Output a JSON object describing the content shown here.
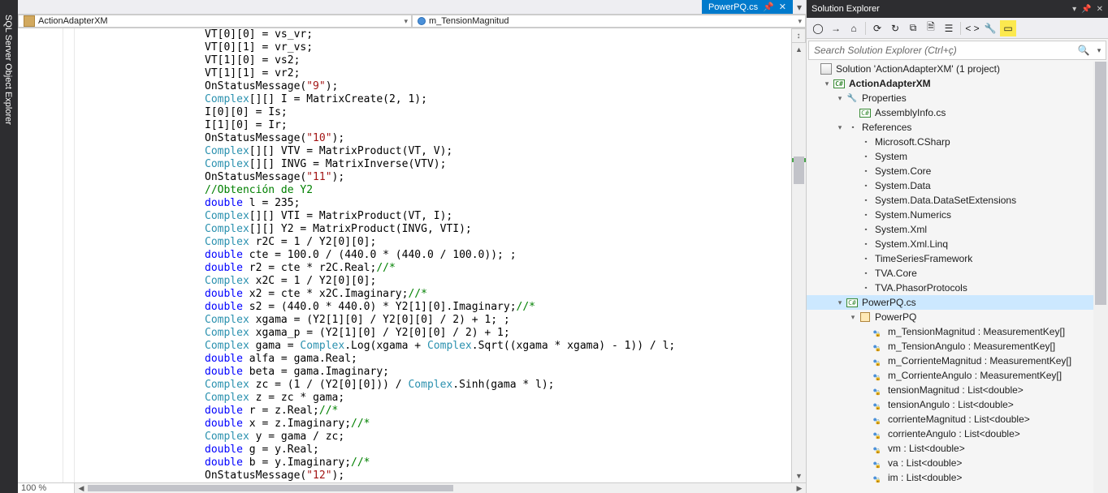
{
  "vertical_tab": "SQL Server Object Explorer",
  "tabs": {
    "active": "PowerPQ.cs",
    "dropdown_glyph": "▾"
  },
  "nav": {
    "left": "ActionAdapterXM",
    "right": "m_TensionMagnitud"
  },
  "zoom": "100 %",
  "code_lines": [
    [
      [
        "",
        "VT[0][0] = vs_vr;"
      ]
    ],
    [
      [
        "",
        "VT[0][1] = vr_vs;"
      ]
    ],
    [
      [
        "",
        "VT[1][0] = vs2;"
      ]
    ],
    [
      [
        "",
        "VT[1][1] = vr2;"
      ]
    ],
    [
      [
        "",
        "OnStatusMessage("
      ],
      [
        "str",
        "\"9\""
      ],
      [
        "",
        ");"
      ]
    ],
    [
      [
        "typ",
        "Complex"
      ],
      [
        "",
        "[][] I = MatrixCreate(2, 1);"
      ]
    ],
    [
      [
        "",
        "I[0][0] = Is;"
      ]
    ],
    [
      [
        "",
        "I[1][0] = Ir;"
      ]
    ],
    [
      [
        "",
        "OnStatusMessage("
      ],
      [
        "str",
        "\"10\""
      ],
      [
        "",
        ");"
      ]
    ],
    [
      [
        "typ",
        "Complex"
      ],
      [
        "",
        "[][] VTV = MatrixProduct(VT, V);"
      ]
    ],
    [
      [
        "typ",
        "Complex"
      ],
      [
        "",
        "[][] INVG = MatrixInverse(VTV);"
      ]
    ],
    [
      [
        "",
        "OnStatusMessage("
      ],
      [
        "str",
        "\"11\""
      ],
      [
        "",
        ");"
      ]
    ],
    [
      [
        "com",
        "//Obtención de Y2"
      ]
    ],
    [
      [
        "kw",
        "double"
      ],
      [
        "",
        " l = 235;"
      ]
    ],
    [
      [
        "typ",
        "Complex"
      ],
      [
        "",
        "[][] VTI = MatrixProduct(VT, I);"
      ]
    ],
    [
      [
        "typ",
        "Complex"
      ],
      [
        "",
        "[][] Y2 = MatrixProduct(INVG, VTI);"
      ]
    ],
    [
      [
        "typ",
        "Complex"
      ],
      [
        "",
        " r2C = 1 / Y2[0][0];"
      ]
    ],
    [
      [
        "kw",
        "double"
      ],
      [
        "",
        " cte = 100.0 / (440.0 * (440.0 / 100.0)); ;"
      ]
    ],
    [
      [
        "kw",
        "double"
      ],
      [
        "",
        " r2 = cte * r2C.Real;"
      ],
      [
        "com",
        "//*"
      ]
    ],
    [
      [
        "typ",
        "Complex"
      ],
      [
        "",
        " x2C = 1 / Y2[0][0];"
      ]
    ],
    [
      [
        "kw",
        "double"
      ],
      [
        "",
        " x2 = cte * x2C.Imaginary;"
      ],
      [
        "com",
        "//*"
      ]
    ],
    [
      [
        "kw",
        "double"
      ],
      [
        "",
        " s2 = (440.0 * 440.0) * Y2[1][0].Imaginary;"
      ],
      [
        "com",
        "//*"
      ]
    ],
    [
      [
        "typ",
        "Complex"
      ],
      [
        "",
        " xgama = (Y2[1][0] / Y2[0][0] / 2) + 1; ;"
      ]
    ],
    [
      [
        "typ",
        "Complex"
      ],
      [
        "",
        " xgama_p = (Y2[1][0] / Y2[0][0] / 2) + 1;"
      ]
    ],
    [
      [
        "typ",
        "Complex"
      ],
      [
        "",
        " gama = "
      ],
      [
        "typ",
        "Complex"
      ],
      [
        "",
        ".Log(xgama + "
      ],
      [
        "typ",
        "Complex"
      ],
      [
        "",
        ".Sqrt((xgama * xgama) - 1)) / l;"
      ]
    ],
    [
      [
        "kw",
        "double"
      ],
      [
        "",
        " alfa = gama.Real;"
      ]
    ],
    [
      [
        "kw",
        "double"
      ],
      [
        "",
        " beta = gama.Imaginary;"
      ]
    ],
    [
      [
        "typ",
        "Complex"
      ],
      [
        "",
        " zc = (1 / (Y2[0][0])) / "
      ],
      [
        "typ",
        "Complex"
      ],
      [
        "",
        ".Sinh(gama * l);"
      ]
    ],
    [
      [
        "typ",
        "Complex"
      ],
      [
        "",
        " z = zc * gama;"
      ]
    ],
    [
      [
        "kw",
        "double"
      ],
      [
        "",
        " r = z.Real;"
      ],
      [
        "com",
        "//*"
      ]
    ],
    [
      [
        "kw",
        "double"
      ],
      [
        "",
        " x = z.Imaginary;"
      ],
      [
        "com",
        "//*"
      ]
    ],
    [
      [
        "typ",
        "Complex"
      ],
      [
        "",
        " y = gama / zc;"
      ]
    ],
    [
      [
        "kw",
        "double"
      ],
      [
        "",
        " g = y.Real;"
      ]
    ],
    [
      [
        "kw",
        "double"
      ],
      [
        "",
        " b = y.Imaginary;"
      ],
      [
        "com",
        "//*"
      ]
    ],
    [
      [
        "",
        "OnStatusMessage("
      ],
      [
        "str",
        "\"12\""
      ],
      [
        "",
        ");"
      ]
    ]
  ],
  "solution_explorer": {
    "title": "Solution Explorer",
    "search_placeholder": "Search Solution Explorer (Ctrl+ç)",
    "toolbar": [
      "back",
      "fwd",
      "home",
      "|",
      "sync",
      "refresh",
      "collapse",
      "showall",
      "properties",
      "|",
      "code",
      "wrench",
      "preview"
    ],
    "tree": [
      {
        "d": 0,
        "exp": "",
        "icon": "sln",
        "label": "Solution 'ActionAdapterXM' (1 project)"
      },
      {
        "d": 1,
        "exp": "▾",
        "icon": "proj",
        "label": "ActionAdapterXM",
        "bold": true
      },
      {
        "d": 2,
        "exp": "▾",
        "icon": "wrench",
        "label": "Properties"
      },
      {
        "d": 3,
        "exp": "",
        "icon": "cs",
        "label": "AssemblyInfo.cs"
      },
      {
        "d": 2,
        "exp": "▾",
        "icon": "ref",
        "label": "References"
      },
      {
        "d": 3,
        "exp": "",
        "icon": "asm",
        "label": "Microsoft.CSharp"
      },
      {
        "d": 3,
        "exp": "",
        "icon": "asm",
        "label": "System"
      },
      {
        "d": 3,
        "exp": "",
        "icon": "asm",
        "label": "System.Core"
      },
      {
        "d": 3,
        "exp": "",
        "icon": "asm",
        "label": "System.Data"
      },
      {
        "d": 3,
        "exp": "",
        "icon": "asm",
        "label": "System.Data.DataSetExtensions"
      },
      {
        "d": 3,
        "exp": "",
        "icon": "asm",
        "label": "System.Numerics"
      },
      {
        "d": 3,
        "exp": "",
        "icon": "asm",
        "label": "System.Xml"
      },
      {
        "d": 3,
        "exp": "",
        "icon": "asm",
        "label": "System.Xml.Linq"
      },
      {
        "d": 3,
        "exp": "",
        "icon": "asm",
        "label": "TimeSeriesFramework"
      },
      {
        "d": 3,
        "exp": "",
        "icon": "asm",
        "label": "TVA.Core"
      },
      {
        "d": 3,
        "exp": "",
        "icon": "asm",
        "label": "TVA.PhasorProtocols"
      },
      {
        "d": 2,
        "exp": "▾",
        "icon": "cs",
        "label": "PowerPQ.cs",
        "selected": true
      },
      {
        "d": 3,
        "exp": "▾",
        "icon": "class",
        "label": "PowerPQ"
      },
      {
        "d": 4,
        "exp": "",
        "icon": "field",
        "label": "m_TensionMagnitud : MeasurementKey[]"
      },
      {
        "d": 4,
        "exp": "",
        "icon": "field",
        "label": "m_TensionAngulo : MeasurementKey[]"
      },
      {
        "d": 4,
        "exp": "",
        "icon": "field",
        "label": "m_CorrienteMagnitud : MeasurementKey[]"
      },
      {
        "d": 4,
        "exp": "",
        "icon": "field",
        "label": "m_CorrienteAngulo : MeasurementKey[]"
      },
      {
        "d": 4,
        "exp": "",
        "icon": "field",
        "label": "tensionMagnitud : List<double>"
      },
      {
        "d": 4,
        "exp": "",
        "icon": "field",
        "label": "tensionAngulo : List<double>"
      },
      {
        "d": 4,
        "exp": "",
        "icon": "field",
        "label": "corrienteMagnitud : List<double>"
      },
      {
        "d": 4,
        "exp": "",
        "icon": "field",
        "label": "corrienteAngulo : List<double>"
      },
      {
        "d": 4,
        "exp": "",
        "icon": "field",
        "label": "vm : List<double>"
      },
      {
        "d": 4,
        "exp": "",
        "icon": "field",
        "label": "va : List<double>"
      },
      {
        "d": 4,
        "exp": "",
        "icon": "field",
        "label": "im : List<double>"
      }
    ]
  },
  "toolbar_glyphs": {
    "back": "◯",
    "fwd": "→",
    "home": "⌂",
    "sync": "⟳",
    "refresh": "↻",
    "collapse": "⧉",
    "showall": "🗎",
    "properties": "☰",
    "code": "< >",
    "wrench": "🔧",
    "preview": "▭"
  }
}
